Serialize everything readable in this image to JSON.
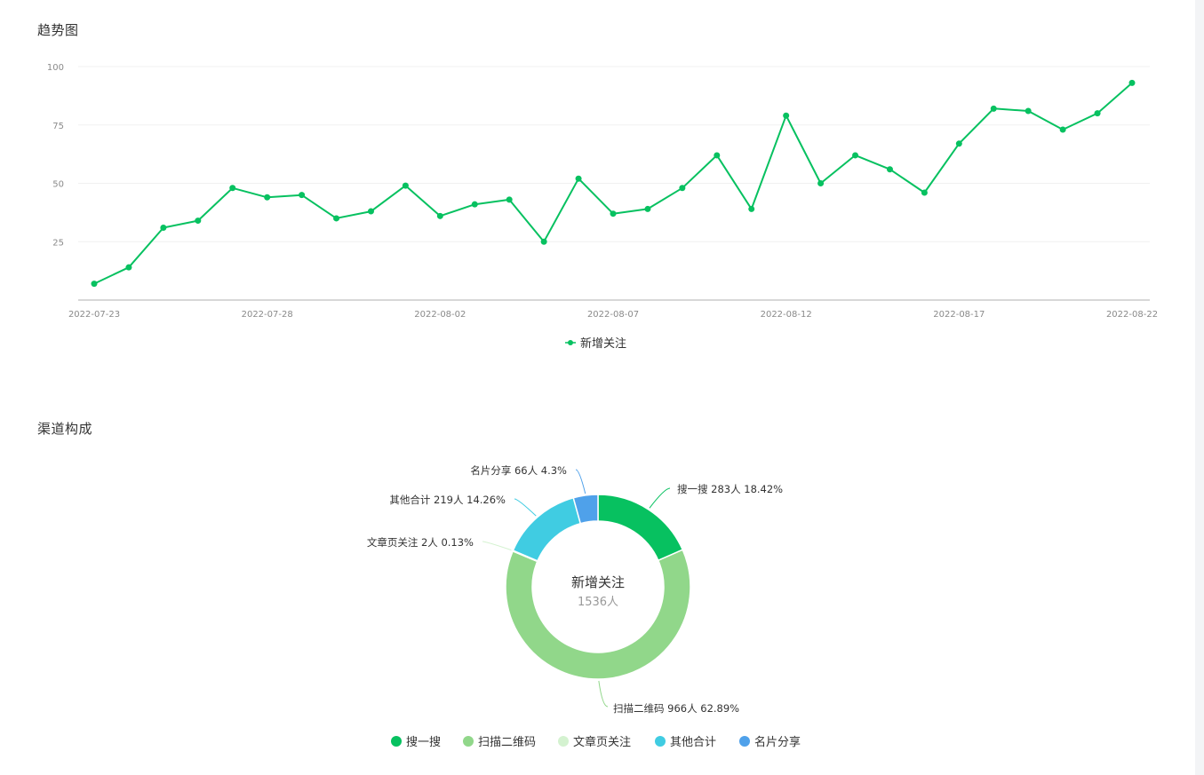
{
  "trend_section": {
    "title": "趋势图"
  },
  "channel_section": {
    "title": "渠道构成"
  },
  "chart_data": [
    {
      "type": "line",
      "x": [
        "2022-07-23",
        "2022-07-24",
        "2022-07-25",
        "2022-07-26",
        "2022-07-27",
        "2022-07-28",
        "2022-07-29",
        "2022-07-30",
        "2022-07-31",
        "2022-08-01",
        "2022-08-02",
        "2022-08-03",
        "2022-08-04",
        "2022-08-05",
        "2022-08-06",
        "2022-08-07",
        "2022-08-08",
        "2022-08-09",
        "2022-08-10",
        "2022-08-11",
        "2022-08-12",
        "2022-08-13",
        "2022-08-14",
        "2022-08-15",
        "2022-08-16",
        "2022-08-17",
        "2022-08-18",
        "2022-08-19",
        "2022-08-20",
        "2022-08-21",
        "2022-08-22"
      ],
      "x_tick_labels": [
        "2022-07-23",
        "2022-07-28",
        "2022-08-02",
        "2022-08-07",
        "2022-08-12",
        "2022-08-17",
        "2022-08-22"
      ],
      "series": [
        {
          "name": "新增关注",
          "color": "#07c160",
          "values": [
            7,
            14,
            31,
            34,
            48,
            44,
            45,
            35,
            38,
            49,
            36,
            41,
            43,
            25,
            52,
            37,
            39,
            48,
            62,
            39,
            79,
            50,
            62,
            56,
            46,
            67,
            82,
            81,
            73,
            80,
            93
          ]
        }
      ],
      "y_ticks": [
        25,
        50,
        75,
        100
      ],
      "ylim": [
        0,
        100
      ],
      "grid": true,
      "legend_position": "bottom"
    },
    {
      "type": "pie",
      "donut": true,
      "center_title": "新增关注",
      "center_value": "1536人",
      "slices": [
        {
          "name": "搜一搜",
          "value": 283,
          "percent": "18.42%",
          "label": "搜一搜 283人 18.42%",
          "color": "#07c160"
        },
        {
          "name": "扫描二维码",
          "value": 966,
          "percent": "62.89%",
          "label": "扫描二维码 966人 62.89%",
          "color": "#91d78a"
        },
        {
          "name": "文章页关注",
          "value": 2,
          "percent": "0.13%",
          "label": "文章页关注 2人 0.13%",
          "color": "#d4f2d0"
        },
        {
          "name": "其他合计",
          "value": 219,
          "percent": "14.26%",
          "label": "其他合计 219人 14.26%",
          "color": "#40cce2"
        },
        {
          "name": "名片分享",
          "value": 66,
          "percent": "4.3%",
          "label": "名片分享 66人 4.3%",
          "color": "#4fa1ea"
        }
      ],
      "legend_position": "bottom"
    }
  ]
}
